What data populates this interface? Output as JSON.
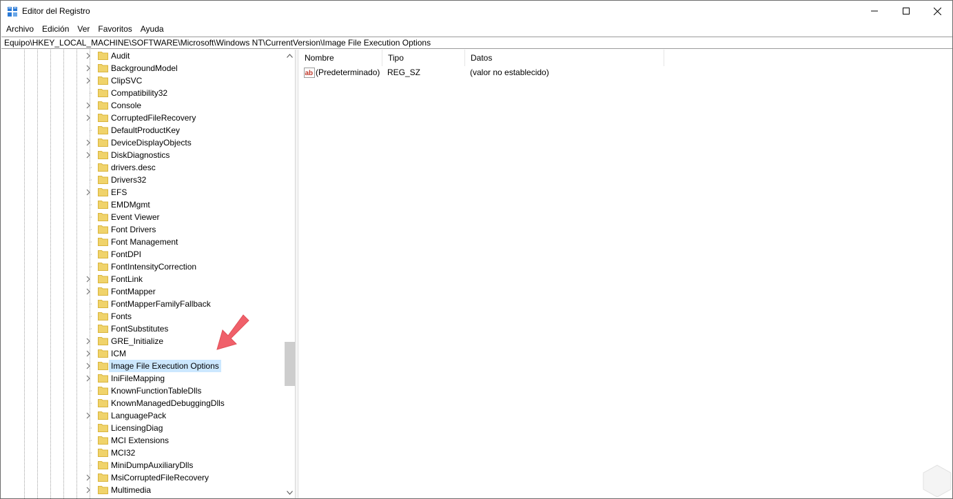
{
  "window": {
    "title": "Editor del Registro"
  },
  "menu": [
    "Archivo",
    "Edición",
    "Ver",
    "Favoritos",
    "Ayuda"
  ],
  "address": "Equipo\\HKEY_LOCAL_MACHINE\\SOFTWARE\\Microsoft\\Windows NT\\CurrentVersion\\Image File Execution Options",
  "tree": {
    "items": [
      {
        "label": "Audit",
        "expandable": true
      },
      {
        "label": "BackgroundModel",
        "expandable": true
      },
      {
        "label": "ClipSVC",
        "expandable": true
      },
      {
        "label": "Compatibility32",
        "expandable": false
      },
      {
        "label": "Console",
        "expandable": true
      },
      {
        "label": "CorruptedFileRecovery",
        "expandable": true
      },
      {
        "label": "DefaultProductKey",
        "expandable": false
      },
      {
        "label": "DeviceDisplayObjects",
        "expandable": true
      },
      {
        "label": "DiskDiagnostics",
        "expandable": true
      },
      {
        "label": "drivers.desc",
        "expandable": false
      },
      {
        "label": "Drivers32",
        "expandable": false
      },
      {
        "label": "EFS",
        "expandable": true
      },
      {
        "label": "EMDMgmt",
        "expandable": false
      },
      {
        "label": "Event Viewer",
        "expandable": false
      },
      {
        "label": "Font Drivers",
        "expandable": false
      },
      {
        "label": "Font Management",
        "expandable": false
      },
      {
        "label": "FontDPI",
        "expandable": false
      },
      {
        "label": "FontIntensityCorrection",
        "expandable": false
      },
      {
        "label": "FontLink",
        "expandable": true
      },
      {
        "label": "FontMapper",
        "expandable": true
      },
      {
        "label": "FontMapperFamilyFallback",
        "expandable": false
      },
      {
        "label": "Fonts",
        "expandable": false
      },
      {
        "label": "FontSubstitutes",
        "expandable": false
      },
      {
        "label": "GRE_Initialize",
        "expandable": true
      },
      {
        "label": "ICM",
        "expandable": true
      },
      {
        "label": "Image File Execution Options",
        "expandable": true,
        "selected": true
      },
      {
        "label": "IniFileMapping",
        "expandable": true
      },
      {
        "label": "KnownFunctionTableDlls",
        "expandable": false
      },
      {
        "label": "KnownManagedDebuggingDlls",
        "expandable": false
      },
      {
        "label": "LanguagePack",
        "expandable": true
      },
      {
        "label": "LicensingDiag",
        "expandable": false
      },
      {
        "label": "MCI Extensions",
        "expandable": false
      },
      {
        "label": "MCI32",
        "expandable": false
      },
      {
        "label": "MiniDumpAuxiliaryDlls",
        "expandable": false
      },
      {
        "label": "MsiCorruptedFileRecovery",
        "expandable": true
      },
      {
        "label": "Multimedia",
        "expandable": true
      }
    ]
  },
  "list": {
    "columns": {
      "name": "Nombre",
      "type": "Tipo",
      "data": "Datos"
    },
    "rows": [
      {
        "name": "(Predeterminado)",
        "type": "REG_SZ",
        "data": "(valor no establecido)",
        "icon": "string-value-icon"
      }
    ]
  },
  "colors": {
    "selection": "#cce8ff",
    "folder": "#f0d36b",
    "arrow": "#f0606a"
  }
}
